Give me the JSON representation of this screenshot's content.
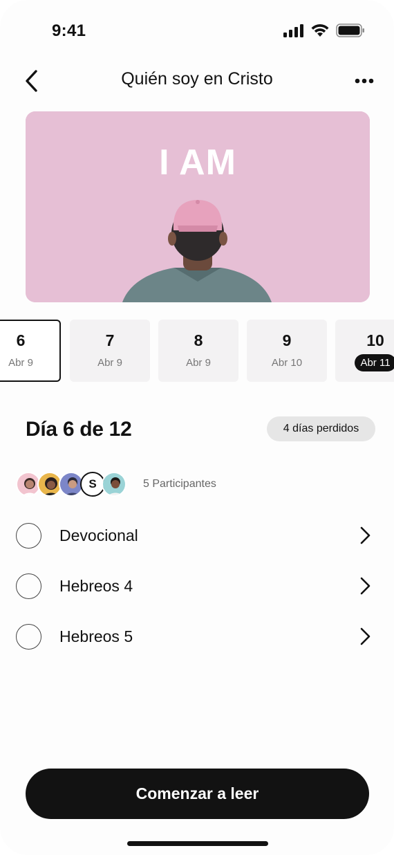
{
  "status_bar": {
    "time": "9:41"
  },
  "header": {
    "title": "Quién soy en Cristo"
  },
  "hero": {
    "text": "I AM",
    "background": "#e6bfd5"
  },
  "days": [
    {
      "num": "6",
      "date": "Abr 9",
      "active": true,
      "today": false
    },
    {
      "num": "7",
      "date": "Abr 9",
      "active": false,
      "today": false
    },
    {
      "num": "8",
      "date": "Abr 9",
      "active": false,
      "today": false
    },
    {
      "num": "9",
      "date": "Abr 10",
      "active": false,
      "today": false
    },
    {
      "num": "10",
      "date": "Abr 11",
      "active": false,
      "today": true
    }
  ],
  "day_info": {
    "heading": "Día 6 de 12",
    "missed": "4 días perdidos"
  },
  "participants": {
    "initial": "S",
    "label": "5 Participantes"
  },
  "tasks": [
    {
      "label": "Devocional",
      "done": false
    },
    {
      "label": "Hebreos 4",
      "done": false
    },
    {
      "label": "Hebreos 5",
      "done": false
    }
  ],
  "cta": {
    "label": "Comenzar a leer"
  },
  "colors": {
    "accent": "#121212",
    "badge_bg": "#e6e6e6",
    "card_bg": "#f3f2f3"
  }
}
